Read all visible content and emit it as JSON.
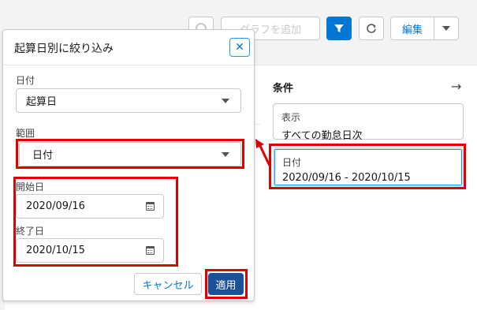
{
  "toolbar": {
    "add_graph_label": "グラフを追加",
    "edit_label": "編集"
  },
  "filter_popover": {
    "title": "起算日別に絞り込み",
    "date_label": "日付",
    "date_value": "起算日",
    "range_label": "範囲",
    "range_value": "日付",
    "start_label": "開始日",
    "start_value": "2020/09/16",
    "end_label": "終了日",
    "end_value": "2020/10/15",
    "cancel_label": "キャンセル",
    "apply_label": "適用"
  },
  "conditions": {
    "title": "条件",
    "cards": [
      {
        "label": "表示",
        "value": "すべての勤怠日次"
      },
      {
        "label": "日付",
        "value": "2020/09/16 - 2020/10/15"
      }
    ]
  },
  "colors": {
    "brand": "#0176d3",
    "apply": "#1b5297",
    "highlight": "#e00000"
  },
  "icons": [
    "search-icon",
    "filter-icon",
    "refresh-icon",
    "chevron-down-icon",
    "close-icon",
    "calendar-icon",
    "arrow-right-icon"
  ]
}
